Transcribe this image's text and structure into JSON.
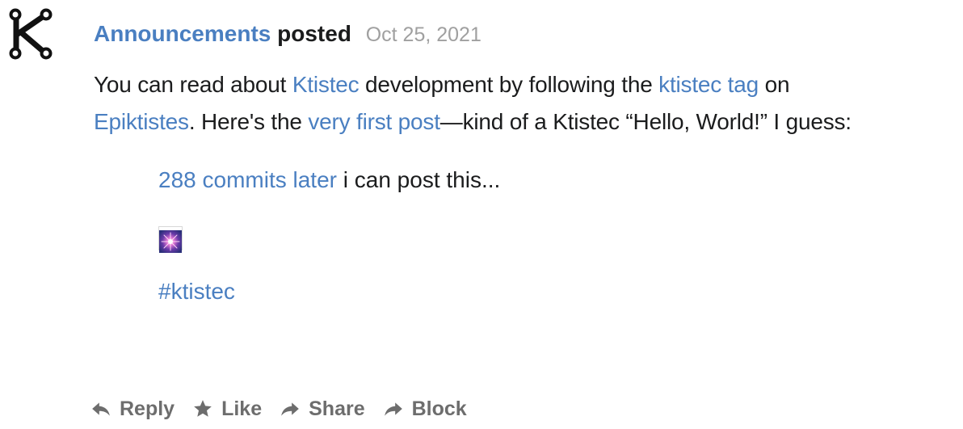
{
  "post": {
    "author": "Announcements",
    "verb": "posted",
    "date": "Oct 25, 2021",
    "body": {
      "t1": "You can read about ",
      "link_ktistec": "Ktistec",
      "t2": " development by following the ",
      "link_tag": "ktistec tag",
      "t3": " on ",
      "link_epiktistes": "Epiktistes",
      "t4": ". Here's the ",
      "link_first_post": "very first post",
      "t5": "—kind of a Ktistec “Hello, World!” I guess:"
    },
    "quote": {
      "link_commits": "288 commits later",
      "text": " i can post this...",
      "hashtag": "#ktistec"
    }
  },
  "actions": {
    "reply": "Reply",
    "like": "Like",
    "share": "Share",
    "block": "Block"
  },
  "colors": {
    "link": "#4a7fc1",
    "muted": "#a0a0a0",
    "action": "#6d6d6d"
  },
  "icons": {
    "avatar": "ktistec-logo-icon",
    "emoji": "sparkle-emoji-icon",
    "reply": "reply-icon",
    "like": "star-icon",
    "share": "share-icon",
    "block": "block-icon"
  }
}
